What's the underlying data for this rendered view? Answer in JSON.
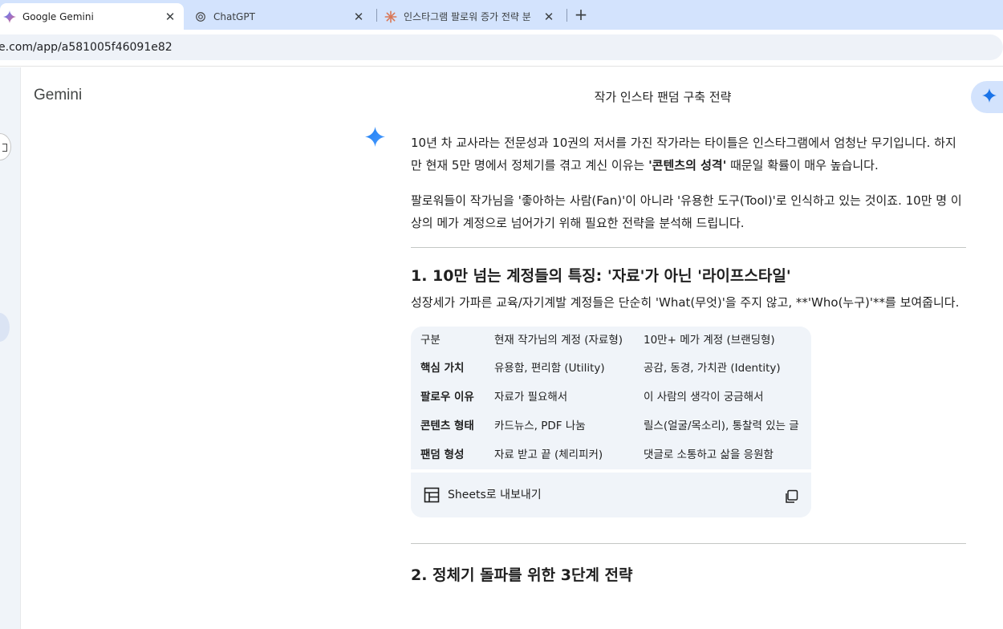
{
  "browser": {
    "tabs": [
      {
        "title": "Google Gemini",
        "active": true,
        "icon": "gemini-icon"
      },
      {
        "title": "ChatGPT",
        "active": false,
        "icon": "chatgpt-icon"
      },
      {
        "title": "인스타그램 팔로워 증가 전략 분",
        "active": false,
        "icon": "claude-icon"
      }
    ],
    "close_glyph": "✕",
    "new_tab_glyph": "+",
    "url": "e.com/app/a581005f46091e82"
  },
  "app": {
    "brand": "Gemini",
    "conversation_title": "작가 인스타 팬덤 구축 전략"
  },
  "response": {
    "intro": {
      "p1_before": "10년 차 교사라는 전문성과 10권의 저서를 가진 작가라는 타이틀은 인스타그램에서 엄청난 무기입니다. 하지만 현재 5만 명에서 정체기를 겪고 계신 이유는 ",
      "p1_bold": "'콘텐츠의 성격'",
      "p1_after": " 때문일 확률이 매우 높습니다.",
      "p2": "팔로워들이 작가님을 '좋아하는 사람(Fan)'이 아니라 '유용한 도구(Tool)'로 인식하고 있는 것이죠. 10만 명 이상의 메가 계정으로 넘어가기 위해 필요한 전략을 분석해 드립니다."
    },
    "section1": {
      "heading": "1. 10만 넘는 계정들의 특징: '자료'가 아닌 '라이프스타일'",
      "body": "성장세가 가파른 교육/자기계발 계정들은 단순히 'What(무엇)'을 주지 않고, **'Who(누구)'**를 보여줍니다."
    },
    "table": {
      "headers": [
        "구분",
        "현재 작가님의 계정 (자료형)",
        "10만+ 메가 계정 (브랜딩형)"
      ],
      "rows": [
        [
          "핵심 가치",
          "유용함, 편리함 (Utility)",
          "공감, 동경, 가치관 (Identity)"
        ],
        [
          "팔로우 이유",
          "자료가 필요해서",
          "이 사람의 생각이 궁금해서"
        ],
        [
          "콘텐츠 형태",
          "카드뉴스, PDF 나눔",
          "릴스(얼굴/목소리), 통찰력 있는 글"
        ],
        [
          "팬덤 형성",
          "자료 받고 끝 (체리피커)",
          "댓글로 소통하고 삶을 응원함"
        ]
      ],
      "export_label": "Sheets로 내보내기"
    },
    "section2": {
      "heading": "2. 정체기 돌파를 위한 3단계 전략"
    }
  },
  "colors": {
    "tabstrip": "#d3e3fd",
    "gemini_blue": "#4285f4",
    "claude_orange": "#d97757"
  }
}
